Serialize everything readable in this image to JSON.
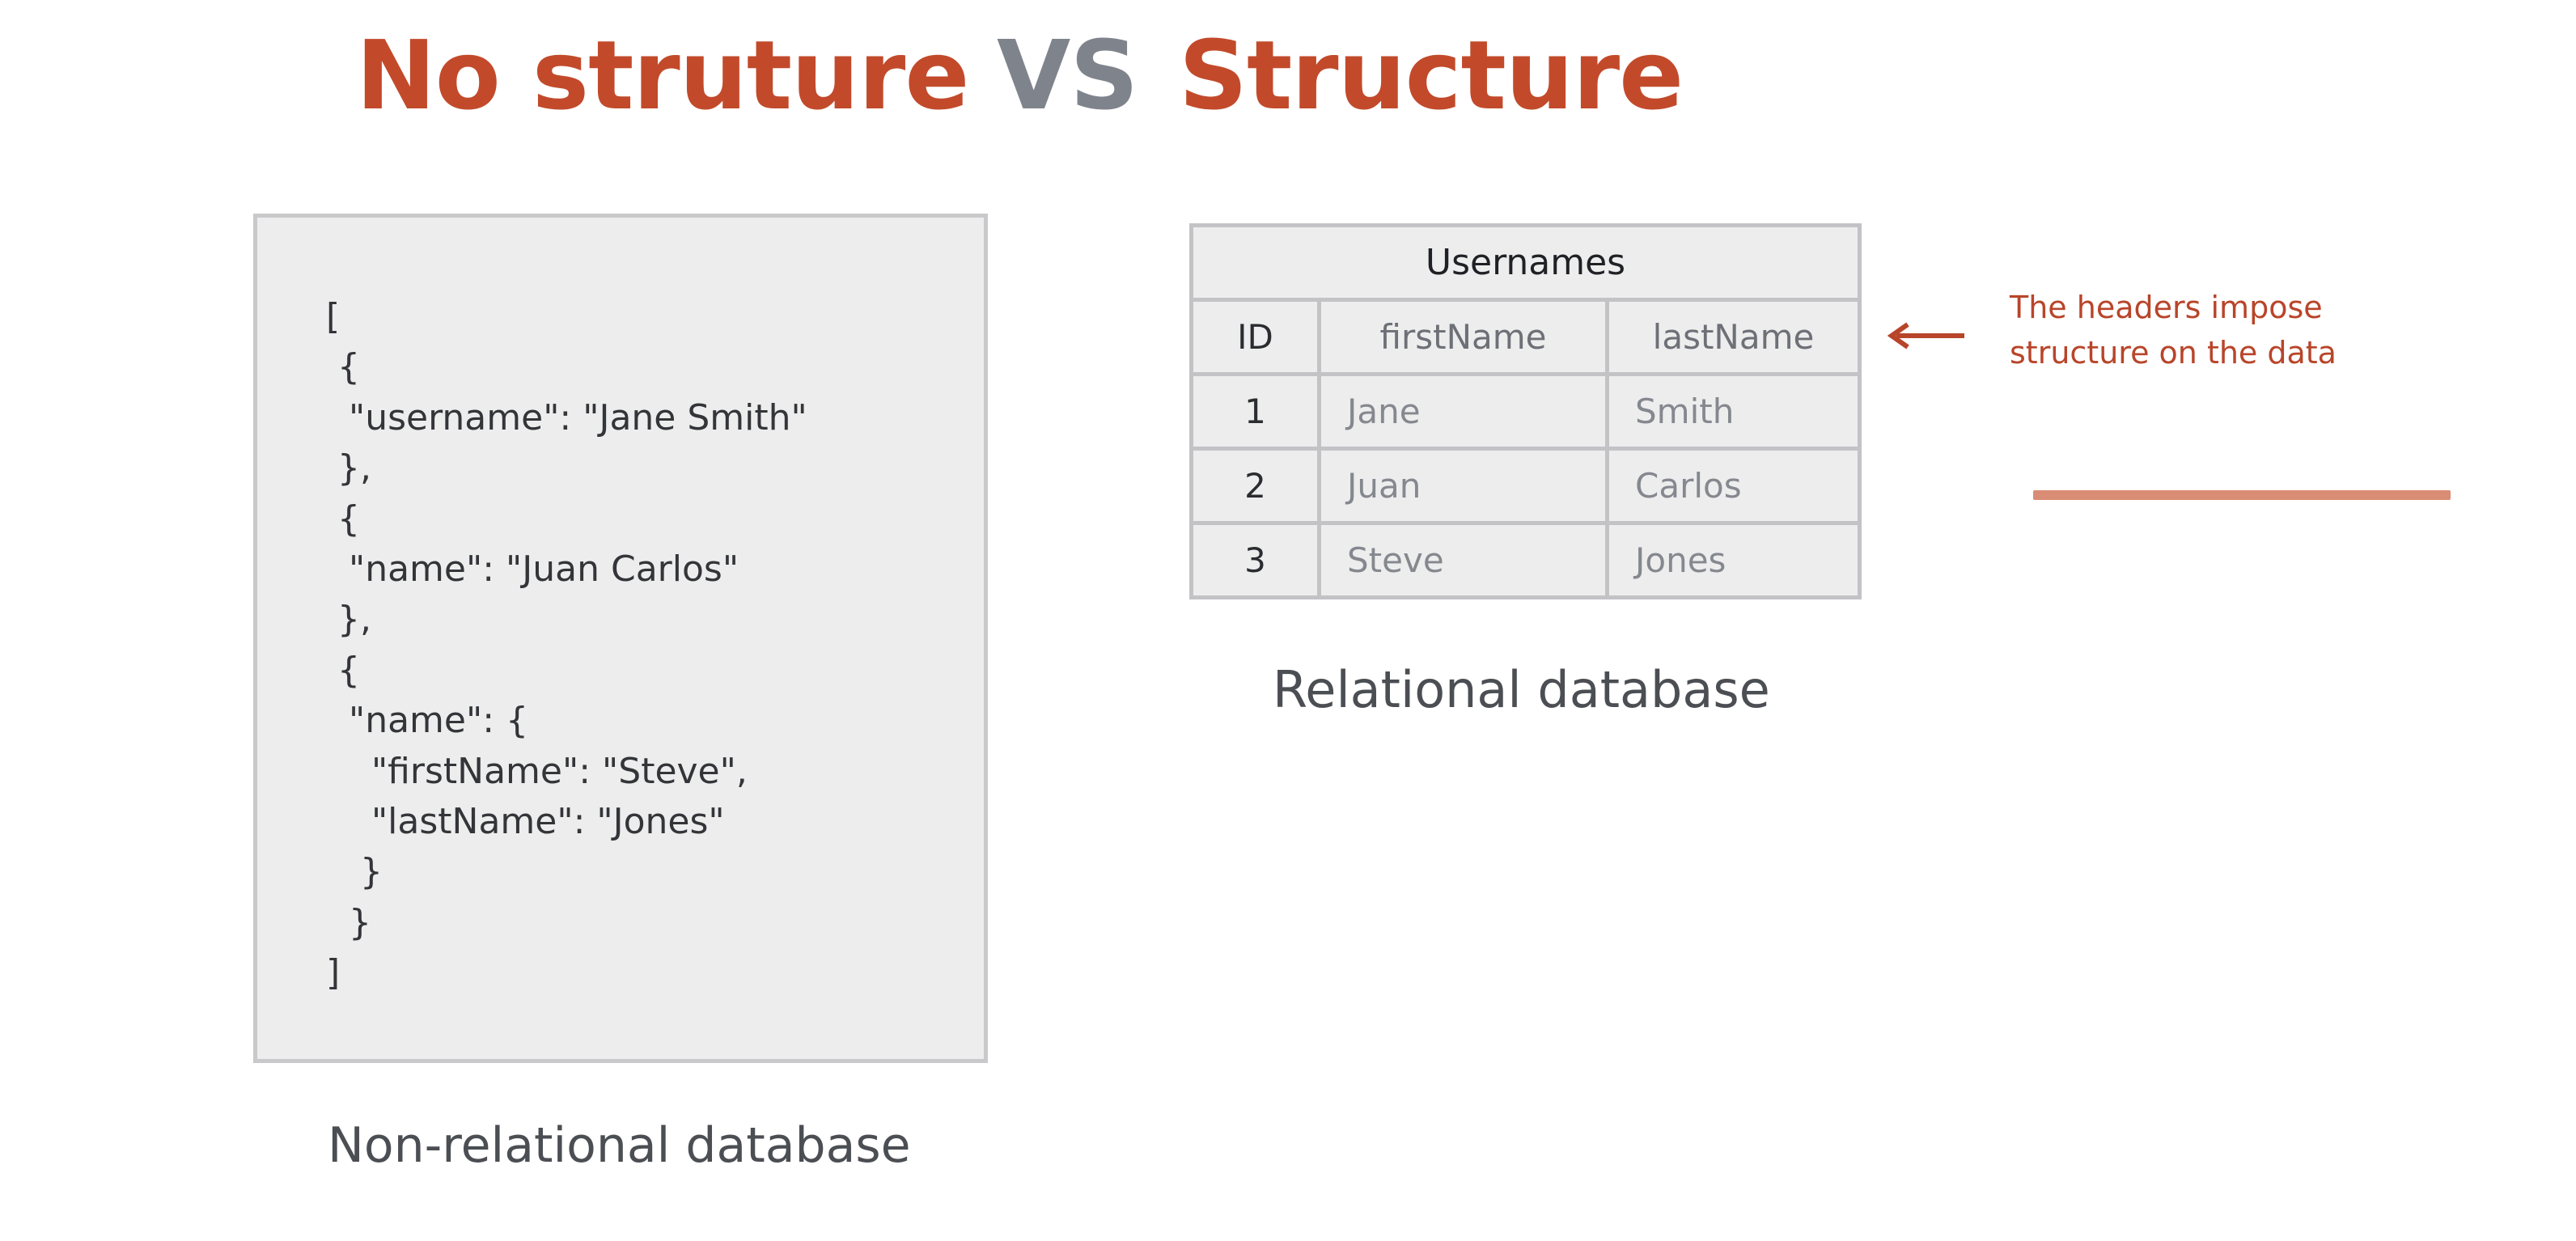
{
  "title": {
    "left": "No struture",
    "vs": "VS",
    "right": "Structure"
  },
  "json_panel": {
    "lines": [
      "[",
      " {",
      "  \"username\": \"Jane Smith\"",
      " },",
      " {",
      "  \"name\": \"Juan Carlos\"",
      " },",
      " {",
      "  \"name\": {",
      "    \"firstName\": \"Steve\",",
      "    \"lastName\": \"Jones\"",
      "   }",
      "  }",
      "]"
    ],
    "caption": "Non-relational database"
  },
  "table": {
    "title": "Usernames",
    "headers": [
      "ID",
      "firstName",
      "lastName"
    ],
    "rows": [
      [
        "1",
        "Jane",
        "Smith"
      ],
      [
        "2",
        "Juan",
        "Carlos"
      ],
      [
        "3",
        "Steve",
        "Jones"
      ]
    ],
    "caption": "Relational database"
  },
  "annotation": {
    "line1": "The headers impose",
    "line2": "structure on the data",
    "arrow_icon": "left-arrow-icon"
  },
  "colors": {
    "accent": "#c24a2b",
    "vs": "#7f848c",
    "annotation": "#b8452a",
    "accent_line": "#d98d74"
  }
}
